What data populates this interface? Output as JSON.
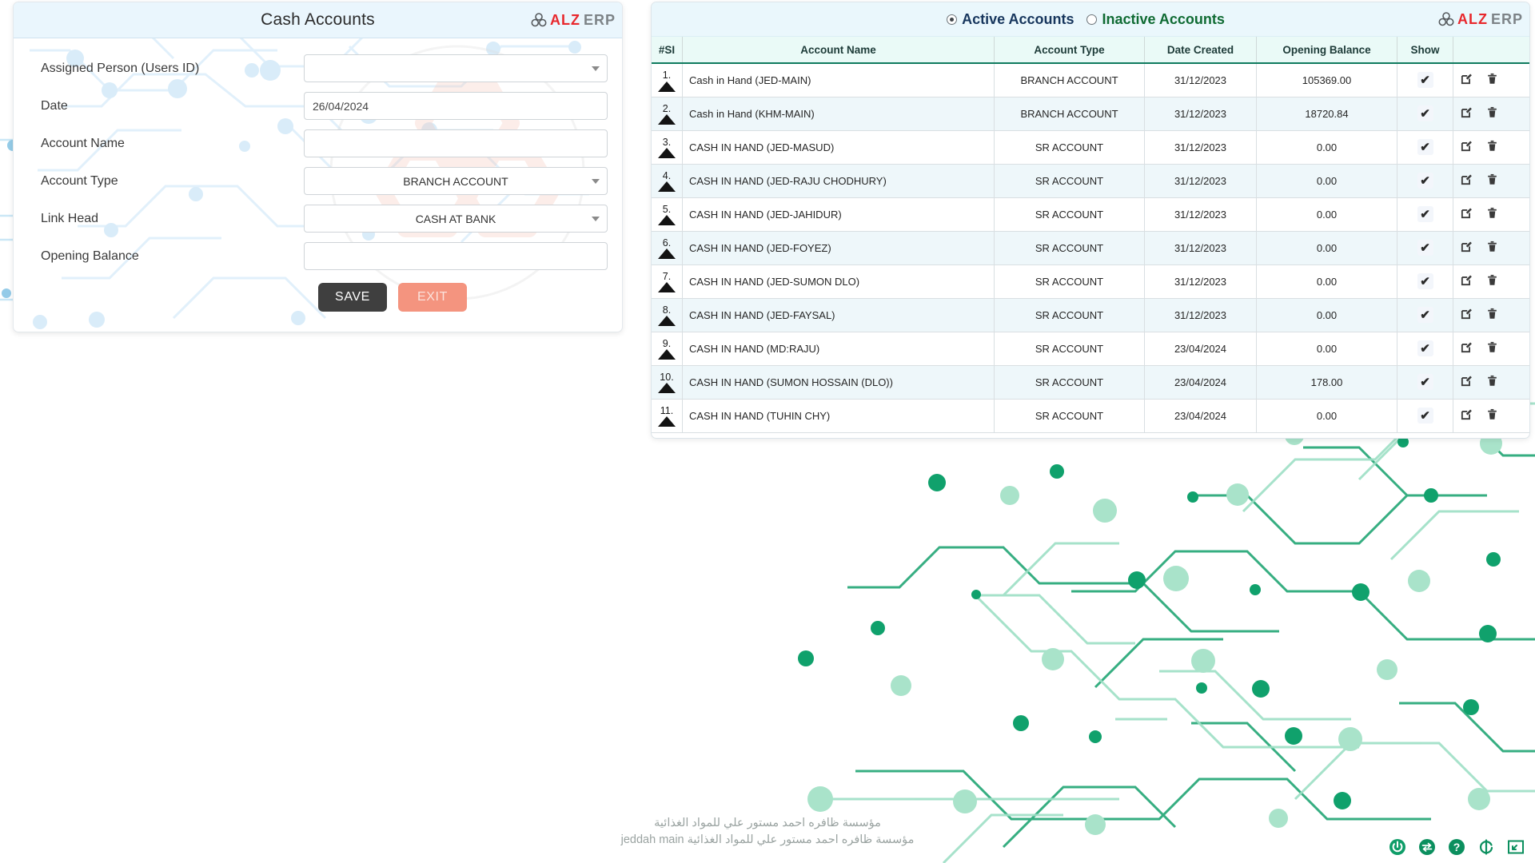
{
  "brand": {
    "name_red": "ALZ",
    "name_gray": "ERP"
  },
  "form": {
    "title": "Cash Accounts",
    "fields": [
      {
        "label": "Assigned Person (Users ID)",
        "value": "",
        "kind": "select",
        "name": "assigned-person"
      },
      {
        "label": "Date",
        "value": "26/04/2024",
        "kind": "input",
        "name": "date"
      },
      {
        "label": "Account Name",
        "value": "",
        "kind": "input",
        "name": "account-name"
      },
      {
        "label": "Account Type",
        "value": "BRANCH ACCOUNT",
        "kind": "select",
        "name": "account-type"
      },
      {
        "label": "Link Head",
        "value": "CASH AT BANK",
        "kind": "select",
        "name": "link-head"
      },
      {
        "label": "Opening Balance",
        "value": "",
        "kind": "input",
        "name": "opening-balance"
      }
    ],
    "save_label": "SAVE",
    "exit_label": "EXIT"
  },
  "list": {
    "filters": [
      {
        "label": "Active Accounts",
        "selected": true,
        "color": "#17365d"
      },
      {
        "label": "Inactive Accounts",
        "selected": false,
        "color": "#0f6b33"
      }
    ],
    "columns": [
      "#SI",
      "Account Name",
      "Account Type",
      "Date Created",
      "Opening Balance",
      "Show",
      ""
    ],
    "rows": [
      {
        "si": "1.",
        "name": "Cash in Hand (JED-MAIN)",
        "type": "BRANCH ACCOUNT",
        "date": "31/12/2023",
        "balance": "105369.00",
        "show": true
      },
      {
        "si": "2.",
        "name": "Cash in Hand (KHM-MAIN)",
        "type": "BRANCH ACCOUNT",
        "date": "31/12/2023",
        "balance": "18720.84",
        "show": true
      },
      {
        "si": "3.",
        "name": "CASH IN HAND (JED-MASUD)",
        "type": "SR ACCOUNT",
        "date": "31/12/2023",
        "balance": "0.00",
        "show": true
      },
      {
        "si": "4.",
        "name": "CASH IN HAND (JED-RAJU CHODHURY)",
        "type": "SR ACCOUNT",
        "date": "31/12/2023",
        "balance": "0.00",
        "show": true
      },
      {
        "si": "5.",
        "name": "CASH IN HAND (JED-JAHIDUR)",
        "type": "SR ACCOUNT",
        "date": "31/12/2023",
        "balance": "0.00",
        "show": true
      },
      {
        "si": "6.",
        "name": "CASH IN HAND (JED-FOYEZ)",
        "type": "SR ACCOUNT",
        "date": "31/12/2023",
        "balance": "0.00",
        "show": true
      },
      {
        "si": "7.",
        "name": "CASH IN HAND (JED-SUMON DLO)",
        "type": "SR ACCOUNT",
        "date": "31/12/2023",
        "balance": "0.00",
        "show": true
      },
      {
        "si": "8.",
        "name": "CASH IN HAND (JED-FAYSAL)",
        "type": "SR ACCOUNT",
        "date": "31/12/2023",
        "balance": "0.00",
        "show": true
      },
      {
        "si": "9.",
        "name": "CASH IN HAND (MD:RAJU)",
        "type": "SR ACCOUNT",
        "date": "23/04/2024",
        "balance": "0.00",
        "show": true
      },
      {
        "si": "10.",
        "name": "CASH IN HAND (SUMON HOSSAIN (DLO))",
        "type": "SR ACCOUNT",
        "date": "23/04/2024",
        "balance": "178.00",
        "show": true
      },
      {
        "si": "11.",
        "name": "CASH IN HAND (TUHIN CHY)",
        "type": "SR ACCOUNT",
        "date": "23/04/2024",
        "balance": "0.00",
        "show": true
      }
    ],
    "check_glyph": "✔",
    "row_actions": [
      "edit-icon",
      "delete-icon"
    ]
  },
  "footer": {
    "line1": "مؤسسة ظافره احمد مستور علي للمواد الغذائية",
    "line2": "jeddah main مؤسسة ظافره احمد مستور علي للمواد الغذائية"
  },
  "corner_tools": [
    "power-icon",
    "swap-icon",
    "help-icon",
    "refresh-icon",
    "fullscreen-icon"
  ],
  "colors": {
    "accent_green": "#0f7a5e",
    "header_blue": "#eaf6fd",
    "table_header": "#eafaf7",
    "row_alt": "#eef7fa",
    "save_bg": "#3f3f3f",
    "exit_bg": "#f4947f",
    "brand_red": "#e8272c",
    "brand_gray": "#7d8387"
  }
}
